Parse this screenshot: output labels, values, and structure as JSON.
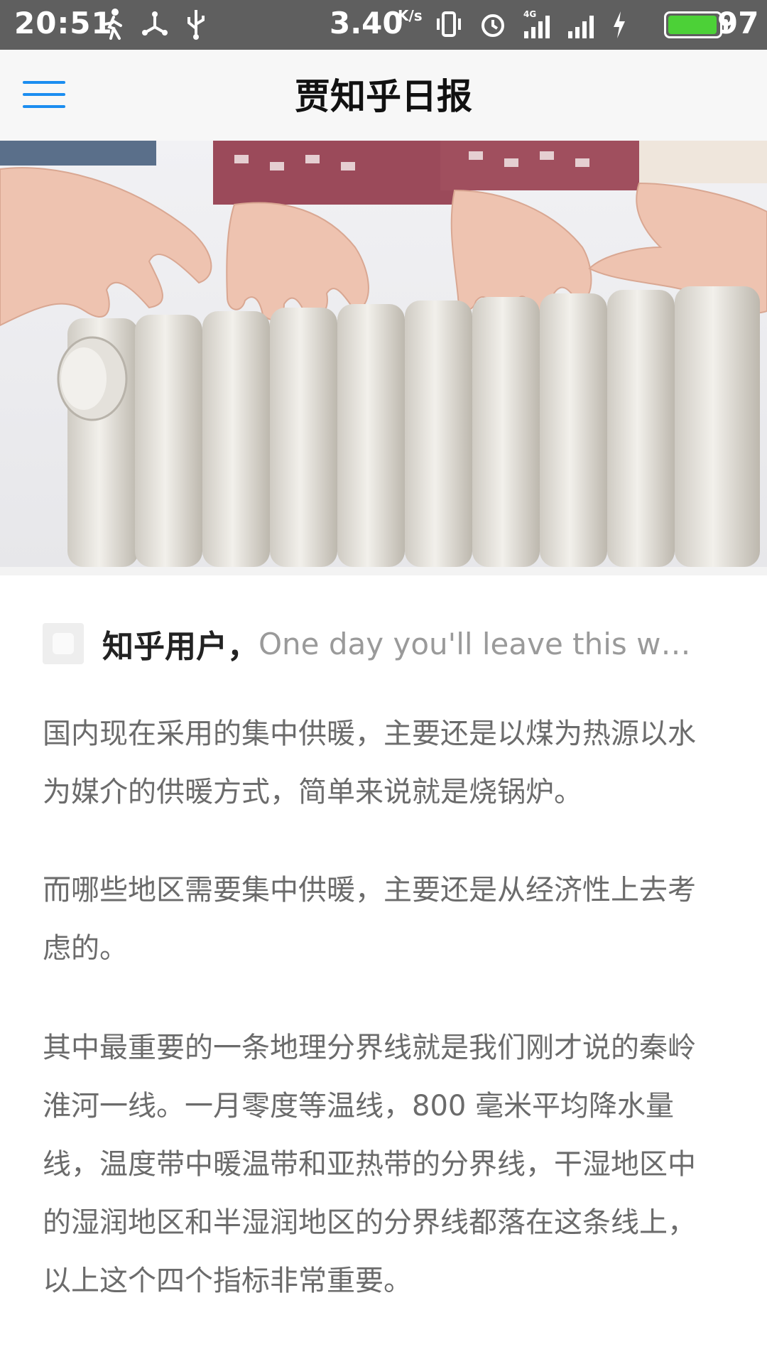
{
  "status_bar": {
    "time": "20:51",
    "speed": "3.40",
    "speed_unit": "K/s",
    "network": "4G",
    "battery_percent": "97",
    "battery_level": 0.97,
    "icons": [
      "walk-icon",
      "share-icon",
      "usb-icon",
      "vibrate-icon",
      "alarm-icon",
      "signal-4g-icon",
      "signal-icon",
      "charging-icon",
      "battery-icon"
    ]
  },
  "app_bar": {
    "title": "贾知乎日报",
    "menu_icon": "menu-icon",
    "accent_color": "#1b8df0"
  },
  "hero_image": {
    "subject": "hands-warming-over-radiator"
  },
  "author": {
    "name": "知乎用户，",
    "bio": "One day you'll leave this world behind so live a life you will remember"
  },
  "article": {
    "paragraphs": [
      "国内现在采用的集中供暖，主要还是以煤为热源以水为媒介的供暖方式，简单来说就是烧锅炉。",
      "而哪些地区需要集中供暖，主要还是从经济性上去考虑的。",
      "其中最重要的一条地理分界线就是我们刚才说的秦岭淮河一线。一月零度等温线，800 毫米平均降水量线，温度带中暖温带和亚热带的分界线，干湿地区中的湿润地区和半湿润地区的分界线都落在这条线上，以上这个四个指标非常重要。"
    ]
  }
}
